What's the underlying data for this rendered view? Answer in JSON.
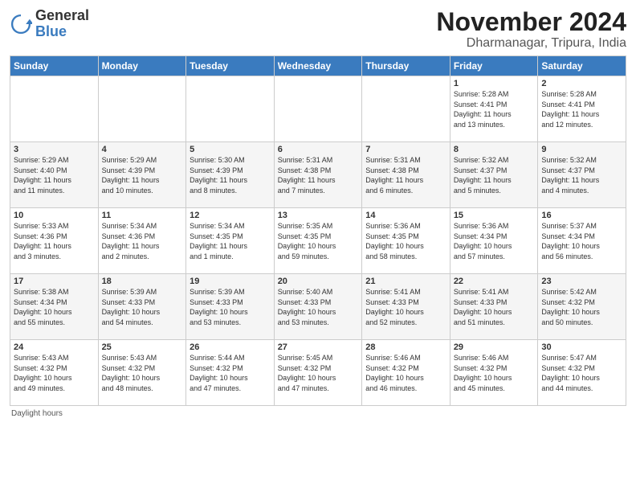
{
  "logo": {
    "text_general": "General",
    "text_blue": "Blue"
  },
  "header": {
    "month_title": "November 2024",
    "location": "Dharmanagar, Tripura, India"
  },
  "weekdays": [
    "Sunday",
    "Monday",
    "Tuesday",
    "Wednesday",
    "Thursday",
    "Friday",
    "Saturday"
  ],
  "footer": {
    "note": "Daylight hours"
  },
  "weeks": [
    [
      {
        "day": "",
        "info": ""
      },
      {
        "day": "",
        "info": ""
      },
      {
        "day": "",
        "info": ""
      },
      {
        "day": "",
        "info": ""
      },
      {
        "day": "",
        "info": ""
      },
      {
        "day": "1",
        "info": "Sunrise: 5:28 AM\nSunset: 4:41 PM\nDaylight: 11 hours\nand 13 minutes."
      },
      {
        "day": "2",
        "info": "Sunrise: 5:28 AM\nSunset: 4:41 PM\nDaylight: 11 hours\nand 12 minutes."
      }
    ],
    [
      {
        "day": "3",
        "info": "Sunrise: 5:29 AM\nSunset: 4:40 PM\nDaylight: 11 hours\nand 11 minutes."
      },
      {
        "day": "4",
        "info": "Sunrise: 5:29 AM\nSunset: 4:39 PM\nDaylight: 11 hours\nand 10 minutes."
      },
      {
        "day": "5",
        "info": "Sunrise: 5:30 AM\nSunset: 4:39 PM\nDaylight: 11 hours\nand 8 minutes."
      },
      {
        "day": "6",
        "info": "Sunrise: 5:31 AM\nSunset: 4:38 PM\nDaylight: 11 hours\nand 7 minutes."
      },
      {
        "day": "7",
        "info": "Sunrise: 5:31 AM\nSunset: 4:38 PM\nDaylight: 11 hours\nand 6 minutes."
      },
      {
        "day": "8",
        "info": "Sunrise: 5:32 AM\nSunset: 4:37 PM\nDaylight: 11 hours\nand 5 minutes."
      },
      {
        "day": "9",
        "info": "Sunrise: 5:32 AM\nSunset: 4:37 PM\nDaylight: 11 hours\nand 4 minutes."
      }
    ],
    [
      {
        "day": "10",
        "info": "Sunrise: 5:33 AM\nSunset: 4:36 PM\nDaylight: 11 hours\nand 3 minutes."
      },
      {
        "day": "11",
        "info": "Sunrise: 5:34 AM\nSunset: 4:36 PM\nDaylight: 11 hours\nand 2 minutes."
      },
      {
        "day": "12",
        "info": "Sunrise: 5:34 AM\nSunset: 4:35 PM\nDaylight: 11 hours\nand 1 minute."
      },
      {
        "day": "13",
        "info": "Sunrise: 5:35 AM\nSunset: 4:35 PM\nDaylight: 10 hours\nand 59 minutes."
      },
      {
        "day": "14",
        "info": "Sunrise: 5:36 AM\nSunset: 4:35 PM\nDaylight: 10 hours\nand 58 minutes."
      },
      {
        "day": "15",
        "info": "Sunrise: 5:36 AM\nSunset: 4:34 PM\nDaylight: 10 hours\nand 57 minutes."
      },
      {
        "day": "16",
        "info": "Sunrise: 5:37 AM\nSunset: 4:34 PM\nDaylight: 10 hours\nand 56 minutes."
      }
    ],
    [
      {
        "day": "17",
        "info": "Sunrise: 5:38 AM\nSunset: 4:34 PM\nDaylight: 10 hours\nand 55 minutes."
      },
      {
        "day": "18",
        "info": "Sunrise: 5:39 AM\nSunset: 4:33 PM\nDaylight: 10 hours\nand 54 minutes."
      },
      {
        "day": "19",
        "info": "Sunrise: 5:39 AM\nSunset: 4:33 PM\nDaylight: 10 hours\nand 53 minutes."
      },
      {
        "day": "20",
        "info": "Sunrise: 5:40 AM\nSunset: 4:33 PM\nDaylight: 10 hours\nand 53 minutes."
      },
      {
        "day": "21",
        "info": "Sunrise: 5:41 AM\nSunset: 4:33 PM\nDaylight: 10 hours\nand 52 minutes."
      },
      {
        "day": "22",
        "info": "Sunrise: 5:41 AM\nSunset: 4:33 PM\nDaylight: 10 hours\nand 51 minutes."
      },
      {
        "day": "23",
        "info": "Sunrise: 5:42 AM\nSunset: 4:32 PM\nDaylight: 10 hours\nand 50 minutes."
      }
    ],
    [
      {
        "day": "24",
        "info": "Sunrise: 5:43 AM\nSunset: 4:32 PM\nDaylight: 10 hours\nand 49 minutes."
      },
      {
        "day": "25",
        "info": "Sunrise: 5:43 AM\nSunset: 4:32 PM\nDaylight: 10 hours\nand 48 minutes."
      },
      {
        "day": "26",
        "info": "Sunrise: 5:44 AM\nSunset: 4:32 PM\nDaylight: 10 hours\nand 47 minutes."
      },
      {
        "day": "27",
        "info": "Sunrise: 5:45 AM\nSunset: 4:32 PM\nDaylight: 10 hours\nand 47 minutes."
      },
      {
        "day": "28",
        "info": "Sunrise: 5:46 AM\nSunset: 4:32 PM\nDaylight: 10 hours\nand 46 minutes."
      },
      {
        "day": "29",
        "info": "Sunrise: 5:46 AM\nSunset: 4:32 PM\nDaylight: 10 hours\nand 45 minutes."
      },
      {
        "day": "30",
        "info": "Sunrise: 5:47 AM\nSunset: 4:32 PM\nDaylight: 10 hours\nand 44 minutes."
      }
    ]
  ]
}
